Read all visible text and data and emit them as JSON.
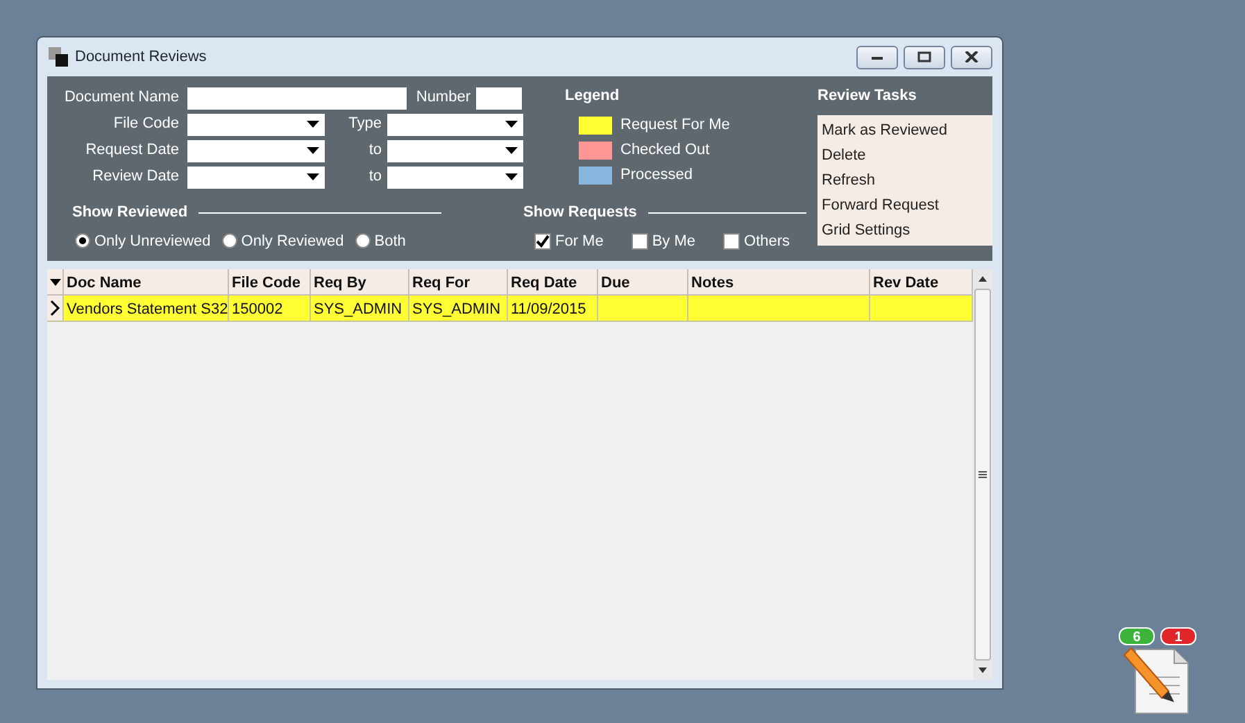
{
  "window": {
    "title": "Document Reviews"
  },
  "filters": [
    {
      "fields": [
        {
          "label": "Document Name",
          "kind": "text"
        },
        {
          "label": "Number",
          "kind": "short"
        }
      ]
    },
    {
      "fields": [
        {
          "label": "File Code",
          "kind": "select"
        },
        {
          "label": "Type",
          "kind": "select"
        }
      ]
    },
    {
      "fields": [
        {
          "label": "Request Date",
          "kind": "select"
        },
        {
          "label": "to",
          "kind": "select"
        }
      ]
    },
    {
      "fields": [
        {
          "label": "Review Date",
          "kind": "select"
        },
        {
          "label": "to",
          "kind": "select"
        }
      ]
    }
  ],
  "legend": {
    "title": "Legend",
    "items": [
      {
        "label": "Request For Me",
        "color": "#ffff33"
      },
      {
        "label": "Checked Out",
        "color": "#ff9595"
      },
      {
        "label": "Processed",
        "color": "#88b8e0"
      }
    ]
  },
  "review_tasks": {
    "title": "Review Tasks",
    "items": [
      "Mark as Reviewed",
      "Delete",
      "Refresh",
      "Forward Request",
      "Grid Settings"
    ]
  },
  "show_reviewed": {
    "title": "Show Reviewed",
    "options": [
      {
        "label": "Only Unreviewed",
        "selected": true
      },
      {
        "label": "Only Reviewed",
        "selected": false
      },
      {
        "label": "Both",
        "selected": false
      }
    ]
  },
  "show_requests": {
    "title": "Show Requests",
    "options": [
      {
        "label": "For Me",
        "checked": true
      },
      {
        "label": "By Me",
        "checked": false
      },
      {
        "label": "Others",
        "checked": false
      }
    ]
  },
  "grid": {
    "columns": [
      "Doc Name",
      "File Code",
      "Req By",
      "Req For",
      "Req Date",
      "Due",
      "Notes",
      "Rev Date"
    ],
    "rows": [
      {
        "cells": [
          "Vendors Statement S32",
          "150002",
          "SYS_ADMIN",
          "SYS_ADMIN",
          "11/09/2015",
          "",
          "",
          ""
        ],
        "current": true,
        "color": "#ffff33"
      }
    ]
  },
  "notification": {
    "badges": [
      {
        "count": "6",
        "color": "#3cb43c"
      },
      {
        "count": "1",
        "color": "#e0262a"
      }
    ]
  }
}
